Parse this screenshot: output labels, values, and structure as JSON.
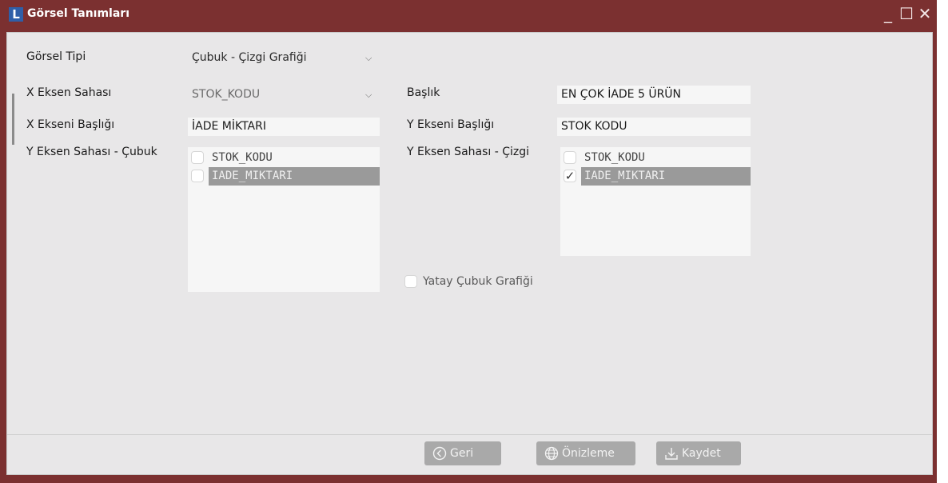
{
  "window": {
    "logo": "L",
    "title": "Görsel Tanımları",
    "controls": {
      "minimize": "_",
      "maximize": "☐",
      "close": "✕"
    }
  },
  "form": {
    "gorsel_tipi": {
      "label": "Görsel Tipi",
      "value": "Çubuk - Çizgi Grafiği"
    },
    "x_eksen_sahasi": {
      "label": "X Eksen Sahası",
      "value": "STOK_KODU"
    },
    "baslik": {
      "label": "Başlık",
      "value": "EN ÇOK İADE 5 ÜRÜN"
    },
    "x_ekseni_basligi": {
      "label": "X Ekseni Başlığı",
      "value": "İADE MİKTARI"
    },
    "y_ekseni_basligi": {
      "label": "Y Ekseni Başlığı",
      "value": "STOK KODU"
    },
    "y_eksen_cubuk": {
      "label": "Y Eksen Sahası - Çubuk",
      "items": [
        {
          "text": "STOK_KODU",
          "checked": false,
          "selected": false
        },
        {
          "text": "IADE_MIKTARI",
          "checked": false,
          "selected": true
        }
      ]
    },
    "y_eksen_cizgi": {
      "label": "Y Eksen Sahası - Çizgi",
      "items": [
        {
          "text": "STOK_KODU",
          "checked": false,
          "selected": false
        },
        {
          "text": "IADE_MIKTARI",
          "checked": true,
          "selected": true
        }
      ]
    },
    "yatay_cubuk": {
      "label": "Yatay Çubuk Grafiği",
      "checked": false
    }
  },
  "buttons": {
    "geri": "Geri",
    "onizleme": "Önizleme",
    "kaydet": "Kaydet"
  }
}
